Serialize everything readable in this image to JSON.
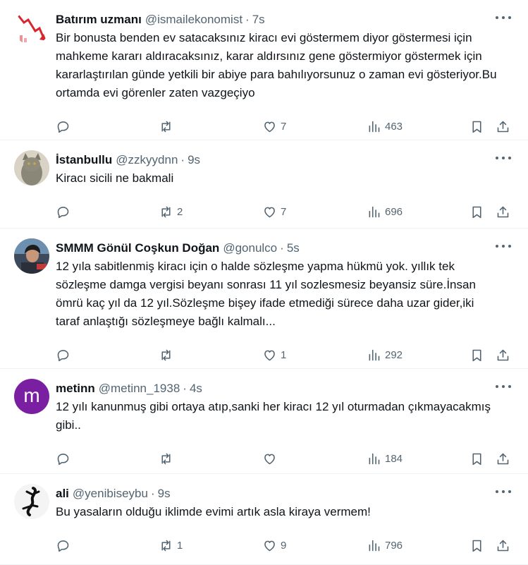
{
  "tweets": [
    {
      "name": "Batırım uzmanı",
      "handle": "@ismailekonomist",
      "time": "7s",
      "text": "Bir bonusta benden ev satacaksınız kiracı evi göstermem diyor göstermesi için mahkeme kararı aldıracaksınız, karar aldırsınız gene göstermiyor göstermek için kararlaştırılan günde yetkili bir abiye para bahılıyorsunuz o zaman evi gösteriyor.Bu ortamda evi görenler zaten vazgeçiyo",
      "reposts": "",
      "likes": "7",
      "views": "463",
      "avatar": "chart-down-avatar"
    },
    {
      "name": "İstanbullu",
      "handle": "@zzkyydnn",
      "time": "9s",
      "text": "Kiracı sicili ne bakmali",
      "reposts": "2",
      "likes": "7",
      "views": "696",
      "avatar": "cat-avatar"
    },
    {
      "name": "SMMM Gönül Coşkun Doğan",
      "handle": "@gonulco",
      "time": "5s",
      "text": "12 yıla sabitlenmiş kiracı için o halde sözleşme yapma hükmü yok. yıllık tek sözleşme damga vergisi beyanı sonrası 11 yıl sozlesmesiz beyansiz süre.İnsan ömrü kaç yıl da 12 yıl.Sözleşme bişey ifade etmediği sürece daha uzar gider,iki taraf anlaştığı sözleşmeye bağlı kalmalı...",
      "reposts": "",
      "likes": "1",
      "views": "292",
      "avatar": "photo-avatar"
    },
    {
      "name": "metinn",
      "handle": "@metinn_1938",
      "time": "4s",
      "text": "12 yılı kanunmuş gibi ortaya atıp,sanki her kiracı 12 yıl oturmadan çıkmayacakmış gibi..",
      "reposts": "",
      "likes": "",
      "views": "184",
      "avatar": "letter-avatar",
      "avatar_letter": "m"
    },
    {
      "name": "ali",
      "handle": "@yenibiseybu",
      "time": "9s",
      "text": "Bu yasaların olduğu iklimde evimi artık asla kiraya vermem!",
      "reposts": "1",
      "likes": "9",
      "views": "796",
      "avatar": "gecko-avatar"
    }
  ],
  "colors": {
    "text": "#0f1419",
    "secondary": "#536471",
    "divider": "#eff3f4",
    "avatar_purple": "#7a1fa2"
  },
  "separator": "·"
}
